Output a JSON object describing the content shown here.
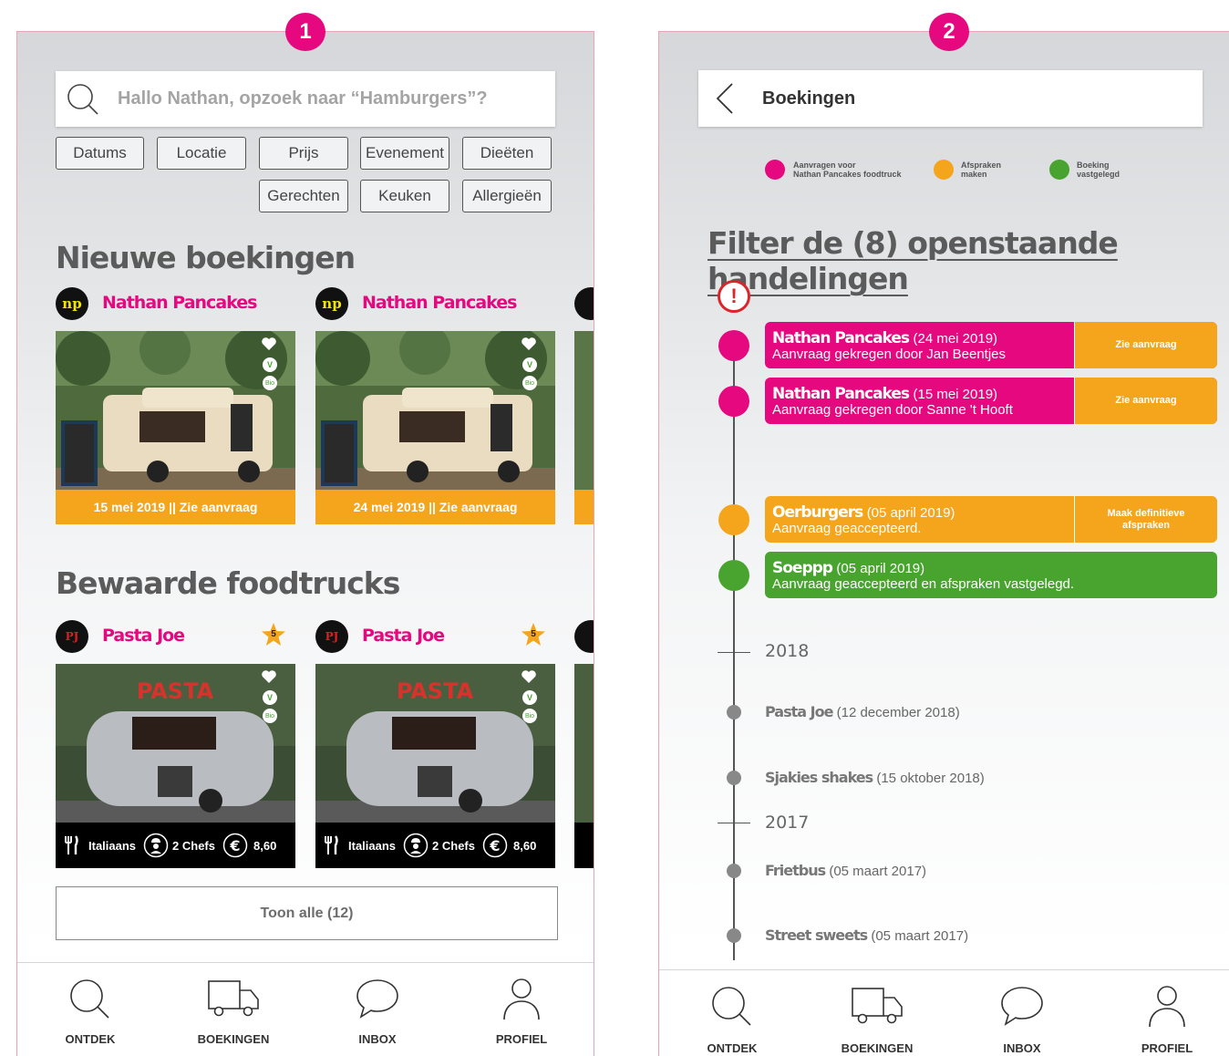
{
  "screen1": {
    "badge": "1",
    "search_placeholder": "Hallo Nathan, opzoek naar “Hamburgers”?",
    "filters": [
      "Datums",
      "Locatie",
      "Prijs",
      "Evenement",
      "Dieëten",
      "Gerechten",
      "Keuken",
      "Allergieën"
    ],
    "new_bookings_title": "Nieuwe boekingen",
    "new_bookings": [
      {
        "logo": "np",
        "name": "Nathan Pancakes",
        "bar": "15 mei 2019 || Zie aanvraag"
      },
      {
        "logo": "np",
        "name": "Nathan Pancakes",
        "bar": "24 mei 2019 || Zie aanvraag"
      }
    ],
    "saved_title": "Bewaarde foodtrucks",
    "saved": [
      {
        "logo": "PJ",
        "name": "Pasta Joe",
        "stars": "5",
        "cuisine": "Italiaans",
        "chefs": "2 Chefs",
        "price": "8,60"
      },
      {
        "logo": "PJ",
        "name": "Pasta Joe",
        "stars": "5",
        "cuisine": "Italiaans",
        "chefs": "2 Chefs",
        "price": "8,60"
      }
    ],
    "show_all": "Toon alle (12)",
    "vegan_label": "V",
    "bio_label": "Bio"
  },
  "screen2": {
    "badge": "2",
    "header_title": "Boekingen",
    "legend": [
      {
        "label_line1": "Aanvragen voor",
        "label_line2": "Nathan Pancakes foodtruck",
        "color": "#e5087e"
      },
      {
        "label_line1": "Afspraken",
        "label_line2": "maken",
        "color": "#f4a51c"
      },
      {
        "label_line1": "Boeking",
        "label_line2": "vastgelegd",
        "color": "#48a42f"
      }
    ],
    "filter_title": "Filter de (8) openstaande handelingen",
    "alert_symbol": "!",
    "entries": [
      {
        "name": "Nathan Pancakes",
        "date": "(24 mei 2019)",
        "sub": "Aanvraag gekregen door Jan Beentjes",
        "action": "Zie aanvraag",
        "color": "#e5087e"
      },
      {
        "name": "Nathan Pancakes",
        "date": "(15 mei 2019)",
        "sub": "Aanvraag gekregen door Sanne 't Hooft",
        "action": "Zie aanvraag",
        "color": "#e5087e"
      },
      {
        "name": "Oerburgers",
        "date": "(05 april 2019)",
        "sub": "Aanvraag geaccepteerd.",
        "action": "Maak definitieve afspraken",
        "color": "#f4a51c"
      },
      {
        "name": "Soeppp",
        "date": "(05 april 2019)",
        "sub": "Aanvraag geaccepteerd en afspraken vastgelegd.",
        "action": "",
        "color": "#48a42f"
      }
    ],
    "years": [
      "2018",
      "2017"
    ],
    "history": [
      {
        "name": "Pasta Joe",
        "date": "(12 december 2018)"
      },
      {
        "name": "Sjakies shakes",
        "date": "(15 oktober 2018)"
      },
      {
        "name": "Frietbus",
        "date": "(05 maart 2017)"
      },
      {
        "name": "Street sweets",
        "date": "(05 maart 2017)"
      }
    ]
  },
  "tabs": [
    "ONTDEK",
    "BOEKINGEN",
    "INBOX",
    "PROFIEL"
  ],
  "colors": {
    "accent": "#e5087e",
    "orange": "#f4a51c",
    "green": "#48a42f"
  }
}
